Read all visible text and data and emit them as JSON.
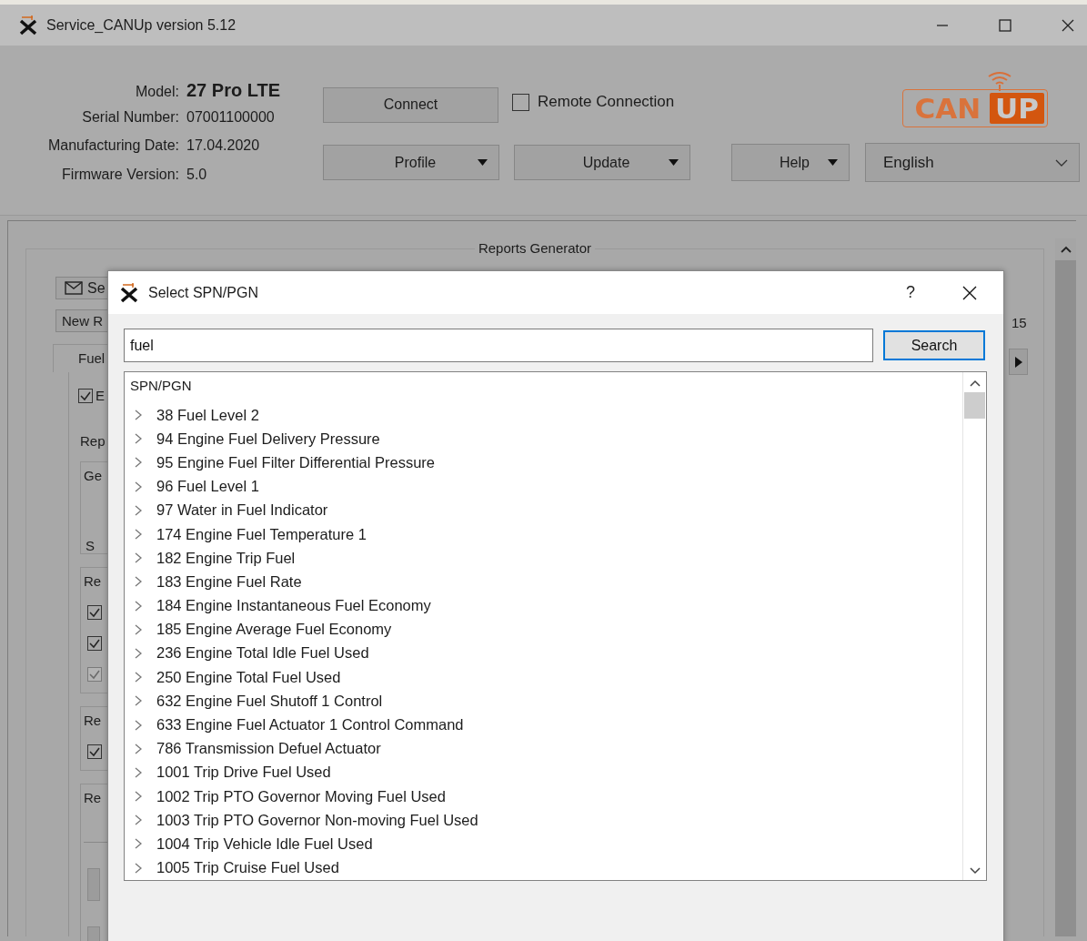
{
  "window": {
    "title": "Service_CANUp version 5.12"
  },
  "device": {
    "model": {
      "label": "Model:",
      "value": "27 Pro LTE"
    },
    "details": [
      {
        "label": "Serial Number:",
        "value": "07001100000"
      },
      {
        "label": "Manufacturing Date:",
        "value": "17.04.2020"
      },
      {
        "label": "Firmware Version:",
        "value": "5.0"
      }
    ]
  },
  "connect_button": "Connect",
  "remote_connection": {
    "label": "Remote Connection",
    "checked": false
  },
  "menu_buttons": [
    "Profile",
    "Update",
    "Help"
  ],
  "language": {
    "value": "English"
  },
  "logo": {
    "left": "CAN",
    "right": "UP"
  },
  "reports": {
    "title": "Reports Generator",
    "send_button": "Se",
    "new_button": "New R",
    "tab": "Fuel",
    "enable": {
      "label": "E",
      "checked": true
    },
    "report_label": "Rep",
    "groups": [
      {
        "kind": "text",
        "title": "Ge",
        "note": "S"
      },
      {
        "kind": "checks",
        "title": "Re",
        "checkboxes": [
          {
            "checked": true,
            "disabled": false
          },
          {
            "checked": true,
            "disabled": false
          },
          {
            "checked": true,
            "disabled": true
          }
        ]
      },
      {
        "kind": "checks",
        "title": "Re",
        "checkboxes": [
          {
            "checked": true,
            "disabled": false
          }
        ]
      },
      {
        "kind": "blocks",
        "title": "Re"
      }
    ],
    "counter": "15"
  },
  "dialog": {
    "title": "Select SPN/PGN",
    "help": "?",
    "search": {
      "value": "fuel"
    },
    "search_button": "Search",
    "list_header": "SPN/PGN",
    "items": [
      {
        "label": "38 Fuel Level 2",
        "expanded": false
      },
      {
        "label": "94 Engine Fuel Delivery Pressure",
        "expanded": false
      },
      {
        "label": "95 Engine Fuel Filter Differential Pressure",
        "expanded": false
      },
      {
        "label": "96 Fuel Level 1",
        "expanded": false
      },
      {
        "label": "97 Water in Fuel Indicator",
        "expanded": false
      },
      {
        "label": "174 Engine Fuel Temperature 1",
        "expanded": false
      },
      {
        "label": "182 Engine Trip Fuel",
        "expanded": false
      },
      {
        "label": "183 Engine Fuel Rate",
        "expanded": false
      },
      {
        "label": "184 Engine Instantaneous Fuel Economy",
        "expanded": false
      },
      {
        "label": "185 Engine Average Fuel Economy",
        "expanded": false
      },
      {
        "label": "236 Engine Total Idle Fuel Used",
        "expanded": false
      },
      {
        "label": "250 Engine Total Fuel Used",
        "expanded": false
      },
      {
        "label": "632 Engine Fuel Shutoff 1 Control",
        "expanded": false
      },
      {
        "label": "633 Engine Fuel Actuator 1 Control Command",
        "expanded": false
      },
      {
        "label": "786 Transmission Defuel Actuator",
        "expanded": false
      },
      {
        "label": "1001 Trip Drive Fuel Used",
        "expanded": false
      },
      {
        "label": "1002 Trip PTO Governor Moving Fuel Used",
        "expanded": false
      },
      {
        "label": "1003 Trip PTO Governor Non-moving Fuel Used",
        "expanded": false
      },
      {
        "label": "1004 Trip Vehicle Idle Fuel Used",
        "expanded": false
      },
      {
        "label": "1005 Trip Cruise Fuel Used",
        "expanded": false
      }
    ]
  }
}
